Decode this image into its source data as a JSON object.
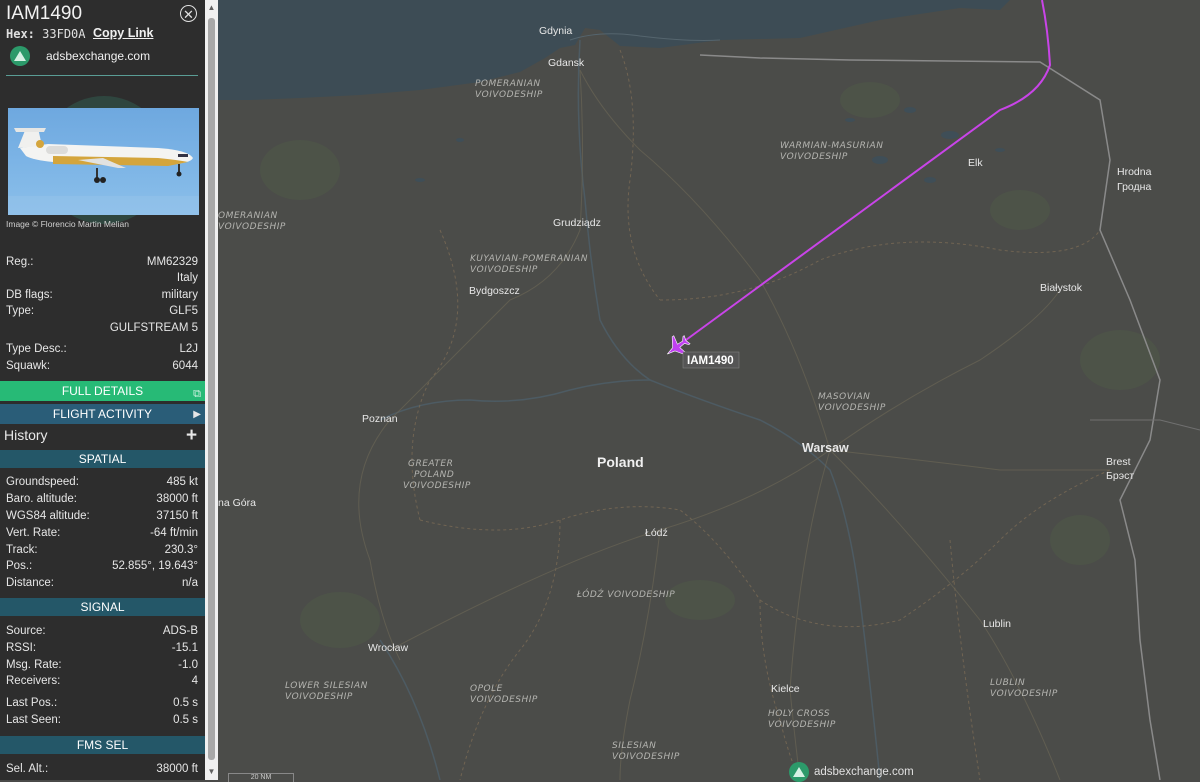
{
  "aircraft": {
    "callsign": "IAM1490",
    "hex_label": "Hex:",
    "hex": "33FD0A",
    "copy_link": "Copy Link",
    "site": "adsbexchange.com",
    "image_credit": "Image © Florencio Martin Melian"
  },
  "details": [
    {
      "k": "Reg.:",
      "v": "MM62329"
    },
    {
      "k": "",
      "v": "Italy"
    },
    {
      "k": "DB flags:",
      "v": "military"
    },
    {
      "k": "Type:",
      "v": "GLF5"
    },
    {
      "k": "",
      "v": "GULFSTREAM 5"
    },
    {
      "k": "Type Desc.:",
      "v": "L2J"
    },
    {
      "k": "Squawk:",
      "v": "6044"
    }
  ],
  "buttons": {
    "full_details": "FULL DETAILS",
    "flight_activity": "FLIGHT ACTIVITY"
  },
  "history_label": "History",
  "sections": {
    "spatial": "SPATIAL",
    "signal": "SIGNAL",
    "fms": "FMS SEL"
  },
  "spatial": [
    {
      "k": "Groundspeed:",
      "v": "485 kt"
    },
    {
      "k": "Baro. altitude:",
      "v": "38000 ft"
    },
    {
      "k": "WGS84 altitude:",
      "v": "37150 ft"
    },
    {
      "k": "Vert. Rate:",
      "v": "-64 ft/min"
    },
    {
      "k": "Track:",
      "v": "230.3°"
    },
    {
      "k": "Pos.:",
      "v": "52.855°, 19.643°"
    },
    {
      "k": "Distance:",
      "v": "n/a"
    }
  ],
  "signal": [
    {
      "k": "Source:",
      "v": "ADS-B"
    },
    {
      "k": "RSSI:",
      "v": "-15.1"
    },
    {
      "k": "Msg. Rate:",
      "v": "-1.0"
    },
    {
      "k": "Receivers:",
      "v": "4"
    },
    {
      "k": "Last Pos.:",
      "v": "0.5 s"
    },
    {
      "k": "Last Seen:",
      "v": "0.5 s"
    }
  ],
  "fms": [
    {
      "k": "Sel. Alt.:",
      "v": "38000 ft"
    }
  ],
  "map": {
    "aircraft_label": "IAM1490",
    "country": "Poland",
    "cities": [
      {
        "name": "Gdynia",
        "big": false
      },
      {
        "name": "Gdansk",
        "big": false
      },
      {
        "name": "Elk",
        "big": false
      },
      {
        "name": "Hrodna",
        "big": false
      },
      {
        "name": "Гродна",
        "big": false
      },
      {
        "name": "Grudziądz",
        "big": false
      },
      {
        "name": "Bydgoszcz",
        "big": false
      },
      {
        "name": "Białystok",
        "big": false
      },
      {
        "name": "Poznan",
        "big": false
      },
      {
        "name": "Warsaw",
        "big": true
      },
      {
        "name": "Brest",
        "big": false
      },
      {
        "name": "Брэст",
        "big": false
      },
      {
        "name": "Łódź",
        "big": false
      },
      {
        "name": "Lublin",
        "big": false
      },
      {
        "name": "Wrocław",
        "big": false
      },
      {
        "name": "Kielce",
        "big": false
      },
      {
        "name": "na Góra",
        "big": false
      }
    ],
    "regions": [
      {
        "l1": "POMERANIAN",
        "l2": "VOIVODESHIP"
      },
      {
        "l1": "WARMIAN-MASURIAN",
        "l2": "VOIVODESHIP"
      },
      {
        "l1": "OMERANIAN",
        "l2": "VOIVODESHIP"
      },
      {
        "l1": "KUYAVIAN-POMERANIAN",
        "l2": "VOIVODESHIP"
      },
      {
        "l1": "MASOVIAN",
        "l2": "VOIVODESHIP"
      },
      {
        "l1": "GREATER",
        "l2": "POLAND",
        "l3": "VOIVODESHIP"
      },
      {
        "l1": "ŁÓDŹ VOIVODESHIP"
      },
      {
        "l1": "LOWER SILESIAN",
        "l2": "VOIVODESHIP"
      },
      {
        "l1": "OPOLE",
        "l2": "VOIVODESHIP"
      },
      {
        "l1": "HOLY CROSS",
        "l2": "VOIVODESHIP"
      },
      {
        "l1": "LUBLIN",
        "l2": "VOIVODESHIP"
      },
      {
        "l1": "SILESIAN",
        "l2": "VOIVODESHIP"
      }
    ],
    "attribution": "adsbexchange.com",
    "scale_label": "20 NM"
  },
  "colors": {
    "track": "#c944e8",
    "aircraft_icon": "#c040f0",
    "full_details_bg": "#27ba76",
    "section_bg": "#245768"
  }
}
